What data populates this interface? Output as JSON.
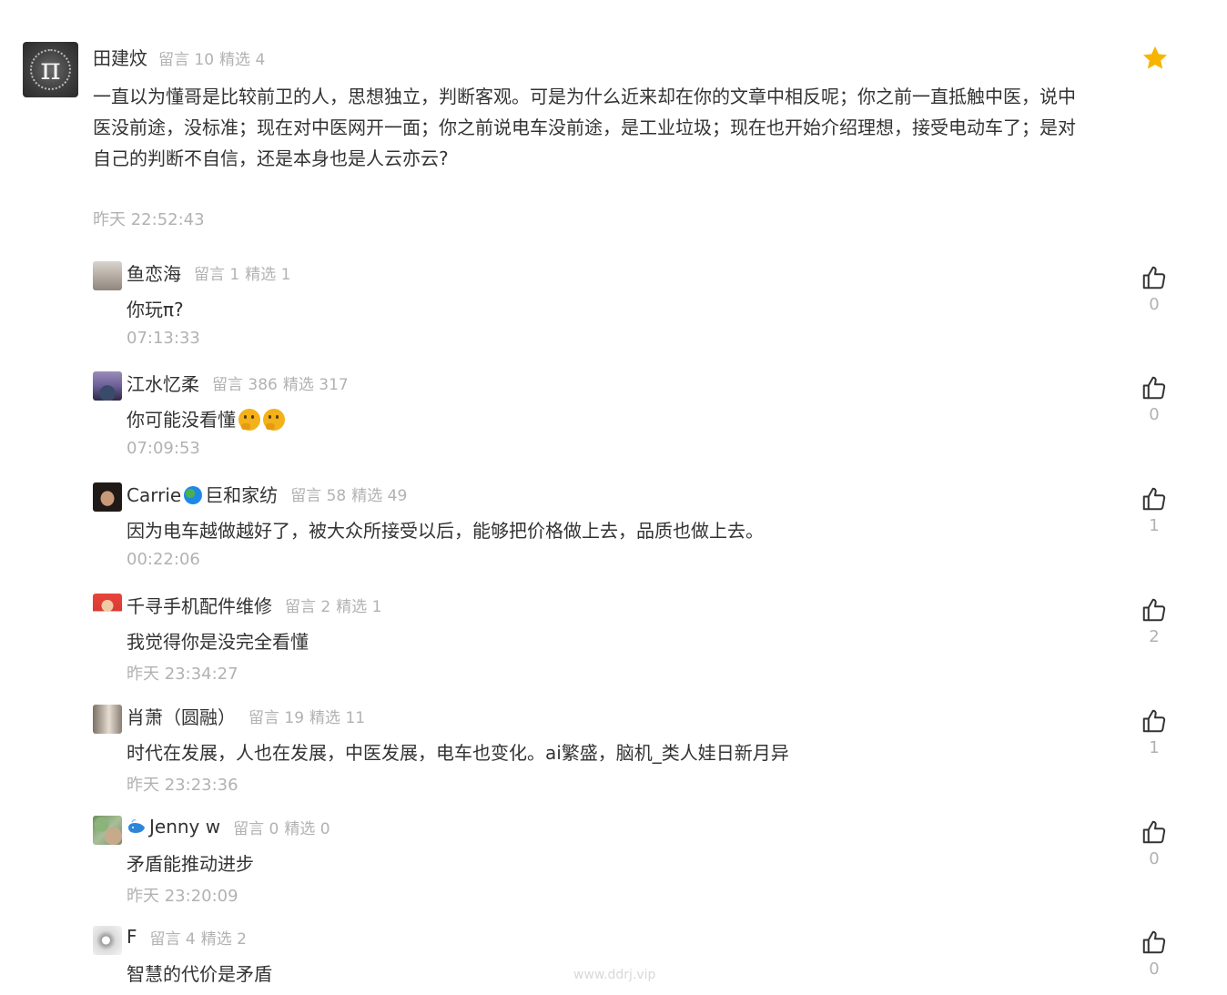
{
  "main_comment": {
    "author": "田建炆",
    "message_count_label": "留言 10",
    "featured_count_label": "精选 4",
    "text": "一直以为懂哥是比较前卫的人，思想独立，判断客观。可是为什么近来却在你的文章中相反呢；你之前一直抵触中医，说中医没前途，没标准；现在对中医网开一面；你之前说电车没前途，是工业垃圾；现在也开始介绍理想，接受电动车了；是对自己的判断不自信，还是本身也是人云亦云?",
    "time": "昨天 22:52:43",
    "avatar_symbol": "π",
    "star_color": "#f7b500"
  },
  "replies": [
    {
      "name": "鱼恋海",
      "msg": "留言 1",
      "sel": "精选 1",
      "text": "你玩π?",
      "time": "07:13:33",
      "likes": "0"
    },
    {
      "name": "江水忆柔",
      "msg": "留言 386",
      "sel": "精选 317",
      "text": "你可能没看懂",
      "time": "07:09:53",
      "likes": "0"
    },
    {
      "name_prefix": "Carrie",
      "name_suffix": "巨和家纺",
      "msg": "留言 58",
      "sel": "精选 49",
      "text": "因为电车越做越好了，被大众所接受以后，能够把价格做上去，品质也做上去。",
      "time": "00:22:06",
      "likes": "1"
    },
    {
      "name": "千寻手机配件维修",
      "msg": "留言 2",
      "sel": "精选 1",
      "text": "我觉得你是没完全看懂",
      "time": "昨天 23:34:27",
      "likes": "2"
    },
    {
      "name": "肖萧（圆融）",
      "msg": "留言 19",
      "sel": "精选 11",
      "text": "时代在发展，人也在发展，中医发展，电车也变化。ai繁盛，脑机_类人娃日新月异",
      "time": "昨天 23:23:36",
      "likes": "1"
    },
    {
      "name": "Jenny w",
      "msg": "留言 0",
      "sel": "精选 0",
      "text": "矛盾能推动进步",
      "time": "昨天 23:20:09",
      "likes": "0"
    },
    {
      "name": "F",
      "msg": "留言 4",
      "sel": "精选 2",
      "text": "智慧的代价是矛盾",
      "time": "",
      "likes": "0"
    }
  ],
  "watermark": "www.ddrj.vip",
  "icons": {
    "like": "thumbs-up-icon",
    "star": "star-icon"
  },
  "colors": {
    "meta_text": "#b2b2b2",
    "body_text": "#333333",
    "star": "#f7b500"
  }
}
